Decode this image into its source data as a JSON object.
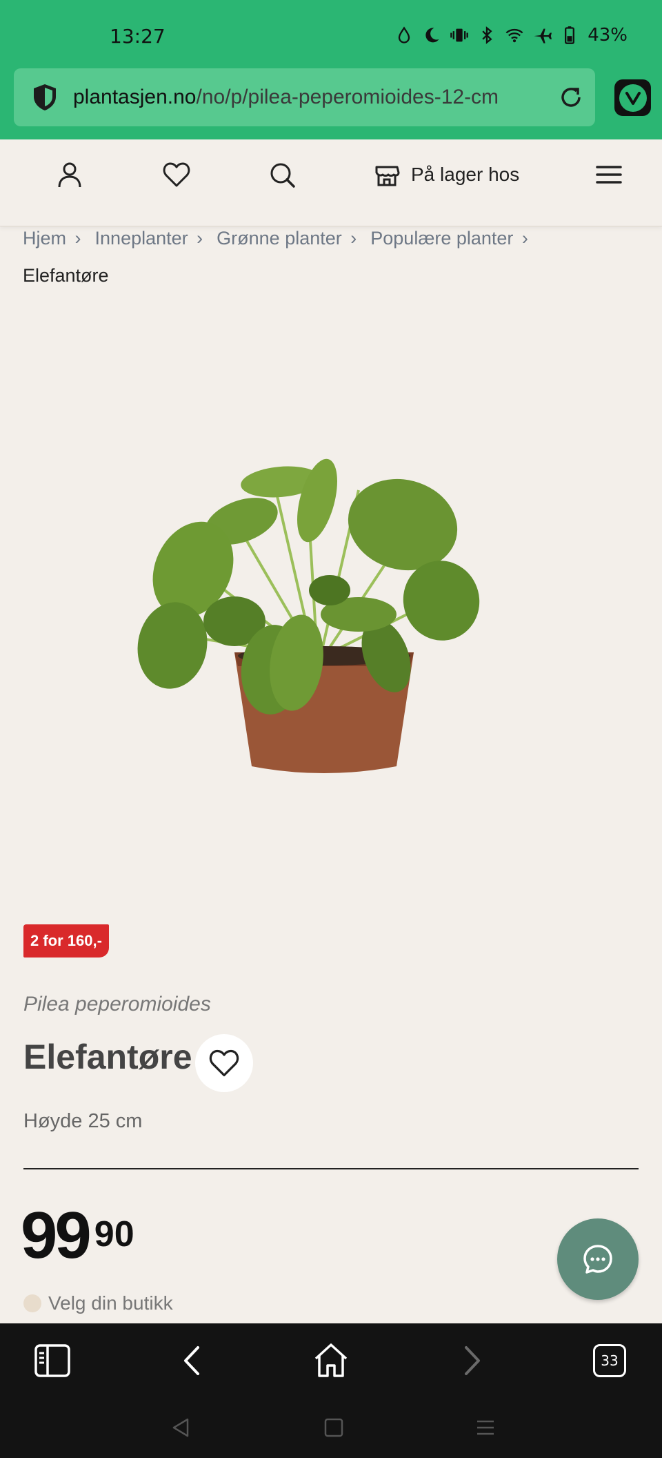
{
  "status_bar": {
    "time": "13:27",
    "battery": "43%",
    "icons": [
      "drop-icon",
      "moon-icon",
      "vibrate-icon",
      "bluetooth-icon",
      "wifi-icon",
      "airplane-icon",
      "battery-icon"
    ]
  },
  "browser": {
    "url_domain": "plantasjen.no",
    "url_path": "/no/p/pilea-peperomioides-12-cm",
    "tab_count": "33"
  },
  "header": {
    "stock_label": "På lager hos"
  },
  "breadcrumb": {
    "items": [
      "Hjem",
      "Inneplanter",
      "Grønne planter",
      "Populære planter"
    ],
    "current": "Elefantøre"
  },
  "product": {
    "promo": "2 for 160,-",
    "latin_name": "Pilea peperomioides",
    "name": "Elefantøre",
    "height": "Høyde 25 cm",
    "price_main": "99",
    "price_decimals": "90",
    "store_prompt": "Velg din butikk"
  },
  "colors": {
    "brand_green": "#2bb673",
    "promo_red": "#d9292b",
    "chat_green": "#5f8c7c"
  }
}
